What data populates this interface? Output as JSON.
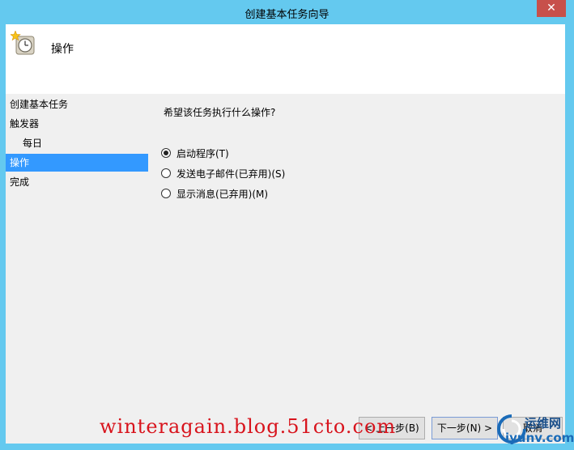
{
  "window": {
    "title": "创建基本任务向导",
    "close_glyph": "✕"
  },
  "header": {
    "title": "操作",
    "icon": "clock-star-icon"
  },
  "nav": {
    "items": [
      {
        "label": "创建基本任务",
        "selected": false,
        "sub": false
      },
      {
        "label": "触发器",
        "selected": false,
        "sub": false
      },
      {
        "label": "每日",
        "selected": false,
        "sub": true
      },
      {
        "label": "操作",
        "selected": true,
        "sub": false
      },
      {
        "label": "完成",
        "selected": false,
        "sub": false
      }
    ]
  },
  "content": {
    "question": "希望该任务执行什么操作?",
    "options": [
      {
        "label": "启动程序(T)",
        "checked": true
      },
      {
        "label": "发送电子邮件(已弃用)(S)",
        "checked": false
      },
      {
        "label": "显示消息(已弃用)(M)",
        "checked": false
      }
    ]
  },
  "buttons": {
    "back": "< 上一步(B)",
    "next": "下一步(N) >",
    "cancel": "取消"
  },
  "watermark": {
    "text": "winteragain.blog.51cto.com"
  },
  "logo": {
    "top": "运维网",
    "bottom": "iyunv.com"
  },
  "colors": {
    "title_bar": "#64c9ef",
    "close_button": "#c7504b",
    "selection": "#3399ff",
    "watermark": "#d8141d"
  }
}
